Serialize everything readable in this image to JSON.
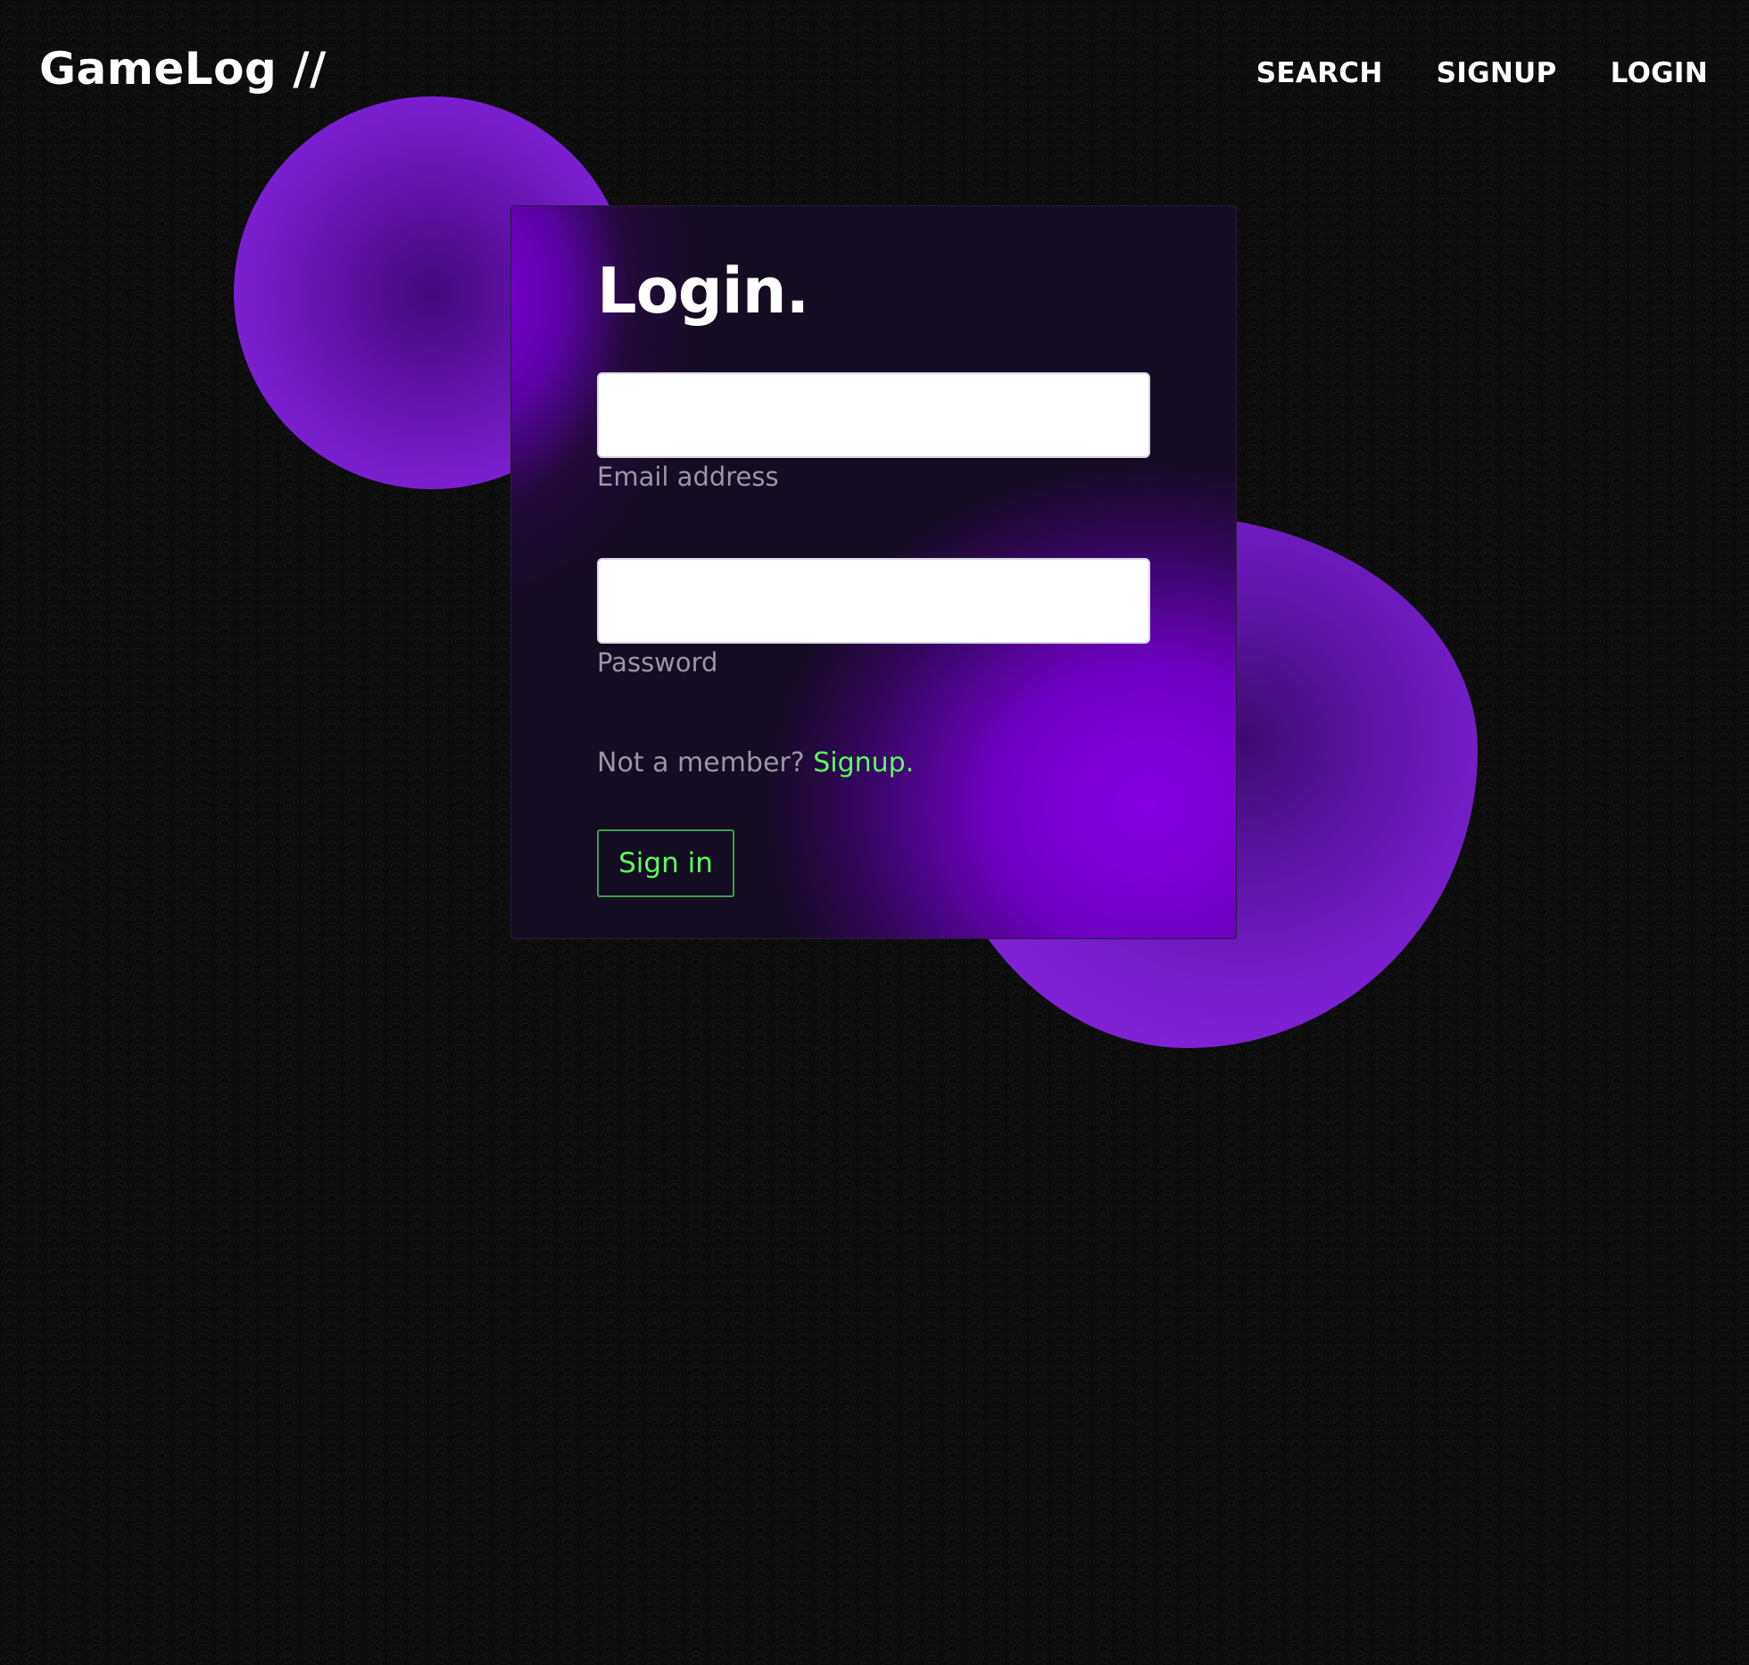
{
  "header": {
    "brand": "GameLog //",
    "nav": [
      {
        "label": "SEARCH"
      },
      {
        "label": "SIGNUP"
      },
      {
        "label": "LOGIN"
      }
    ]
  },
  "login": {
    "title": "Login.",
    "email_label": "Email address",
    "email_value": "",
    "password_label": "Password",
    "password_value": "",
    "signup_prompt": "Not a member? ",
    "signup_link": "Signup.",
    "submit_label": "Sign in"
  },
  "colors": {
    "background": "#0b0b0b",
    "accent_purple": "#7a1fcf",
    "link_green": "#5cff5c",
    "button_border": "#3b9f4f",
    "card": "#140c20"
  }
}
